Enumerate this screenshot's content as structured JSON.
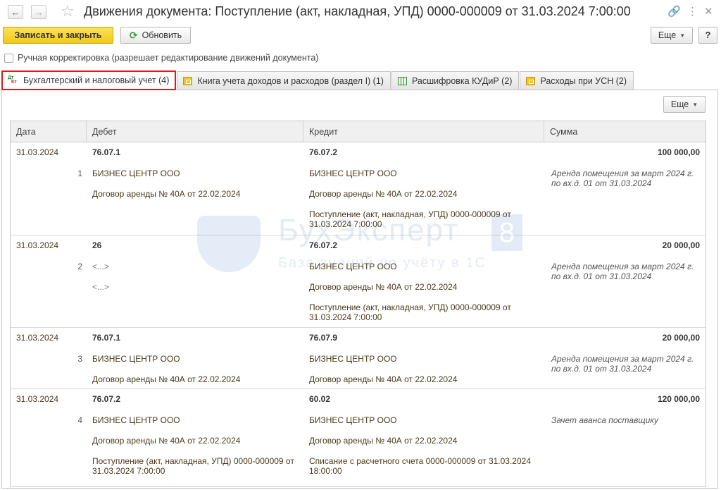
{
  "window": {
    "title": "Движения документа: Поступление (акт, накладная, УПД) 0000-000009 от 31.03.2024 7:00:00"
  },
  "toolbar": {
    "save_close": "Записать и закрыть",
    "refresh": "Обновить",
    "more": "Еще",
    "help": "?"
  },
  "manual_edit": {
    "label": "Ручная корректировка (разрешает редактирование движений документа)"
  },
  "tabs": [
    {
      "label": "Бухгалтерский и налоговый учет (4)"
    },
    {
      "label": "Книга учета доходов и расходов (раздел I) (1)"
    },
    {
      "label": "Расшифровка КУДиР (2)"
    },
    {
      "label": "Расходы при УСН (2)"
    }
  ],
  "panel": {
    "more": "Еще"
  },
  "table": {
    "headers": {
      "date": "Дата",
      "debit": "Дебет",
      "credit": "Кредит",
      "sum": "Сумма"
    },
    "rows": [
      {
        "date": "31.03.2024",
        "num": "1",
        "debit": [
          "76.07.1",
          "БИЗНЕС ЦЕНТР ООО",
          "Договор аренды № 40А от 22.02.2024",
          ""
        ],
        "credit": [
          "76.07.2",
          "БИЗНЕС ЦЕНТР ООО",
          "Договор аренды № 40А от 22.02.2024",
          "Поступление (акт, накладная, УПД) 0000-000009 от 31.03.2024 7:00:00"
        ],
        "sum": "100 000,00",
        "note": "Аренда помещения за март 2024 г. по вх.д. 01 от 31.03.2024"
      },
      {
        "date": "31.03.2024",
        "num": "2",
        "debit": [
          "26",
          "<...>",
          "<...>",
          ""
        ],
        "credit": [
          "76.07.2",
          "БИЗНЕС ЦЕНТР ООО",
          "Договор аренды № 40А от 22.02.2024",
          "Поступление (акт, накладная, УПД) 0000-000009 от 31.03.2024 7:00:00"
        ],
        "sum": "20 000,00",
        "note": "Аренда помещения за март 2024 г. по вх.д. 01 от 31.03.2024"
      },
      {
        "date": "31.03.2024",
        "num": "3",
        "debit": [
          "76.07.1",
          "БИЗНЕС ЦЕНТР ООО",
          "Договор аренды № 40А от 22.02.2024",
          ""
        ],
        "credit": [
          "76.07.9",
          "БИЗНЕС ЦЕНТР ООО",
          "Договор аренды № 40А от 22.02.2024",
          ""
        ],
        "sum": "20 000,00",
        "note": "Аренда помещения за март 2024 г. по вх.д. 01 от 31.03.2024"
      },
      {
        "date": "31.03.2024",
        "num": "4",
        "debit": [
          "76.07.2",
          "БИЗНЕС ЦЕНТР ООО",
          "Договор аренды № 40А от 22.02.2024",
          "Поступление (акт, накладная, УПД) 0000-000009 от 31.03.2024 7:00:00"
        ],
        "credit": [
          "60.02",
          "БИЗНЕС ЦЕНТР ООО",
          "Договор аренды № 40А от 22.02.2024",
          "Списание с расчетного счета 0000-000009 от 31.03.2024 18:00:00"
        ],
        "sum": "120 000,00",
        "note": "Зачет аванса поставщику"
      }
    ]
  },
  "watermark": {
    "brand": "БухЭксперт",
    "digit": "8",
    "tagline": "База знаний по учёту в 1С"
  },
  "colors": {
    "primary_button": "#f3c917",
    "active_tab_outline": "#e01818",
    "watermark": "#2a6fc2"
  }
}
